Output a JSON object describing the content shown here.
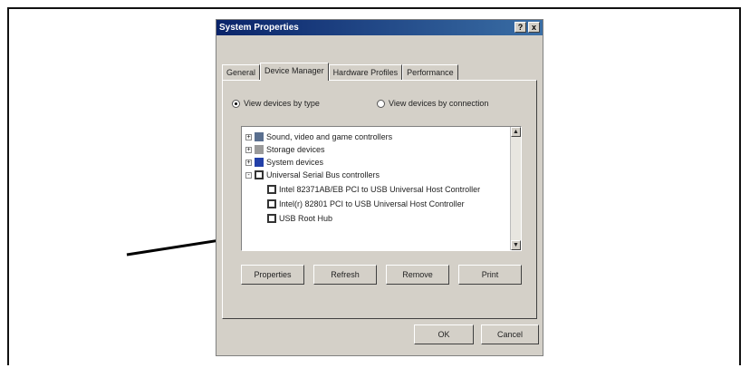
{
  "dialog": {
    "title": "System Properties",
    "help_btn": "?",
    "close_btn": "x"
  },
  "tabs": [
    {
      "label": "General"
    },
    {
      "label": "Device Manager"
    },
    {
      "label": "Hardware Profiles"
    },
    {
      "label": "Performance"
    }
  ],
  "view": {
    "by_type": "View devices by type",
    "by_connection": "View devices by connection",
    "selected": "by_type"
  },
  "tree": [
    {
      "label": "Sound, video and game controllers",
      "expander": "+",
      "icon": "speaker-icon"
    },
    {
      "label": "Storage devices",
      "expander": "+",
      "icon": "storage-icon"
    },
    {
      "label": "System devices",
      "expander": "+",
      "icon": "computer-icon"
    },
    {
      "label": "Universal Serial Bus controllers",
      "expander": "-",
      "icon": "usb-icon"
    },
    {
      "label": "Intel 82371AB/EB PCI to USB Universal Host Controller",
      "expander": "",
      "icon": "usb-device-icon"
    },
    {
      "label": "Intel(r) 82801 PCI to USB Universal Host Controller",
      "expander": "",
      "icon": "usb-device-icon"
    },
    {
      "label": "USB Root Hub",
      "expander": "",
      "icon": "usb-device-icon"
    }
  ],
  "buttons": {
    "properties": "Properties",
    "refresh": "Refresh",
    "remove": "Remove",
    "print": "Print",
    "ok": "OK",
    "cancel": "Cancel"
  },
  "colors": {
    "title_bar": "#0a246a",
    "dialog_bg": "#d4d0c8",
    "arrow": "#000000"
  }
}
